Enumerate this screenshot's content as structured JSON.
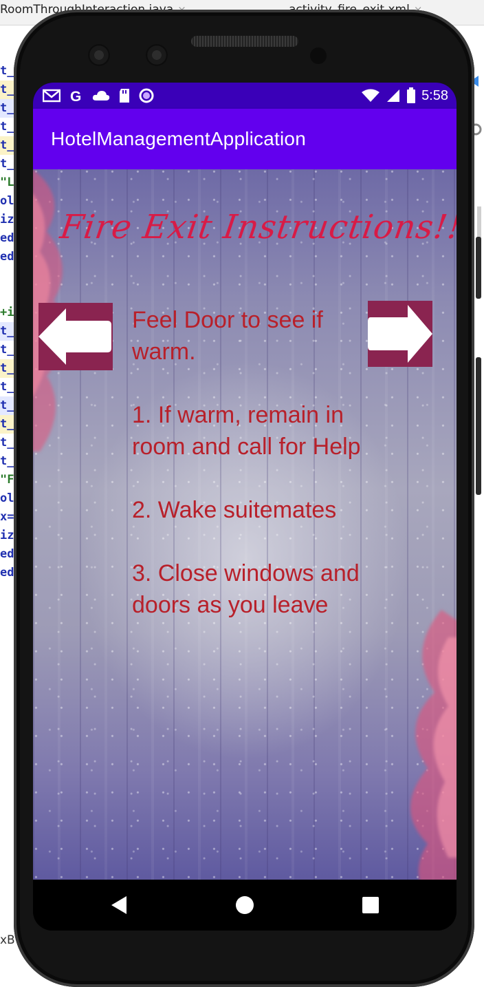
{
  "ide": {
    "tabs": [
      {
        "label": "RoomThroughInteraction.java"
      },
      {
        "label": "activity_fire_exit.xml"
      }
    ],
    "close_glyph": "×",
    "gutter": [
      "t_",
      "t_",
      "t_",
      "t_",
      "t_",
      "t_",
      "\"L",
      "ol",
      "iz",
      "ed",
      "ed",
      "",
      "",
      "+i",
      "t_",
      "t_",
      "t_",
      "t_",
      "t_",
      "t_",
      "t_",
      "t_",
      "\"F",
      "ol",
      "x=",
      "iz",
      "ed",
      "ed"
    ],
    "bottom_text": "xB"
  },
  "status_bar": {
    "left_icons": [
      "gmail-icon",
      "google-icon",
      "cloud-icon",
      "sd-card-icon",
      "circle-app-icon"
    ],
    "time": "5:58",
    "color": "#3a00b8"
  },
  "app_bar": {
    "title": "HotelManagementApplication",
    "color": "#6200ee"
  },
  "content": {
    "heading": "Fire Exit Instructions!!",
    "heading_color": "#d81b46",
    "text_color": "#b8202a",
    "instructions": [
      "Feel Door to see if warm.",
      "1. If warm, remain in room and call for Help",
      "2. Wake suitemates",
      "3. Close windows and doors as you leave"
    ],
    "prev_button": "left-arrow-icon",
    "next_button": "right-arrow-icon",
    "arrow_color": "#8a2450"
  },
  "nav_bar": {
    "buttons": [
      "back-triangle-icon",
      "home-circle-icon",
      "recents-square-icon"
    ]
  }
}
